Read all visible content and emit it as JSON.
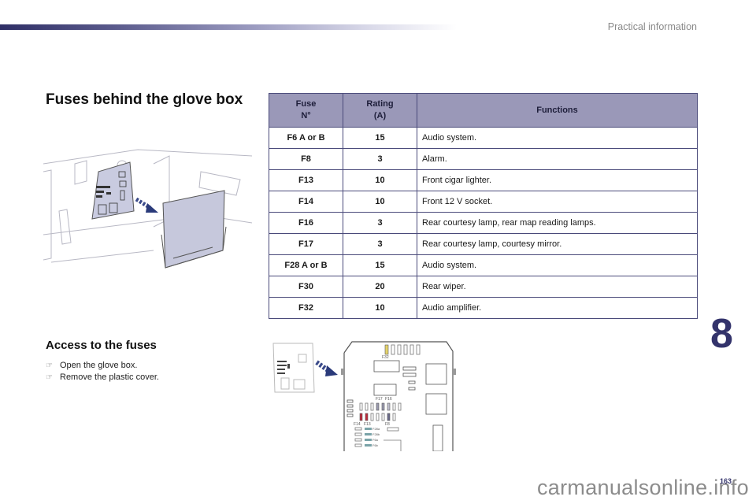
{
  "header": {
    "section": "Practical information",
    "accent_color": "#2f2f66"
  },
  "left": {
    "title": "Fuses behind the glove box",
    "access_title": "Access to the fuses",
    "steps": [
      {
        "icon": "pointing-hand-icon",
        "text": "Open the glove box."
      },
      {
        "icon": "pointing-hand-icon",
        "text": "Remove the plastic cover."
      }
    ]
  },
  "fusebox_labels": {
    "f32": "F32",
    "f17": "F17",
    "f16": "F16",
    "f14": "F14",
    "f13": "F13",
    "f8": "F8",
    "f28a": "F28a",
    "f28b": "F28b",
    "f6a": "F6a",
    "f6b": "F6b"
  },
  "table": {
    "headers": {
      "fuse_line1": "Fuse",
      "fuse_line2": "N°",
      "rating_line1": "Rating",
      "rating_line2": "(A)",
      "functions": "Functions"
    },
    "header_color": "#9a98b8",
    "rows": [
      {
        "fuse": "F6 A or B",
        "rating": "15",
        "function": "Audio system."
      },
      {
        "fuse": "F8",
        "rating": "3",
        "function": "Alarm."
      },
      {
        "fuse": "F13",
        "rating": "10",
        "function": "Front cigar lighter."
      },
      {
        "fuse": "F14",
        "rating": "10",
        "function": "Front 12 V socket."
      },
      {
        "fuse": "F16",
        "rating": "3",
        "function": "Rear courtesy lamp, rear map reading lamps."
      },
      {
        "fuse": "F17",
        "rating": "3",
        "function": "Rear courtesy lamp, courtesy mirror."
      },
      {
        "fuse": "F28 A or B",
        "rating": "15",
        "function": "Audio system."
      },
      {
        "fuse": "F30",
        "rating": "20",
        "function": "Rear wiper."
      },
      {
        "fuse": "F32",
        "rating": "10",
        "function": "Audio amplifier."
      }
    ]
  },
  "chapter": "8",
  "page_number": "163",
  "watermark": "carmanualsonline.info"
}
